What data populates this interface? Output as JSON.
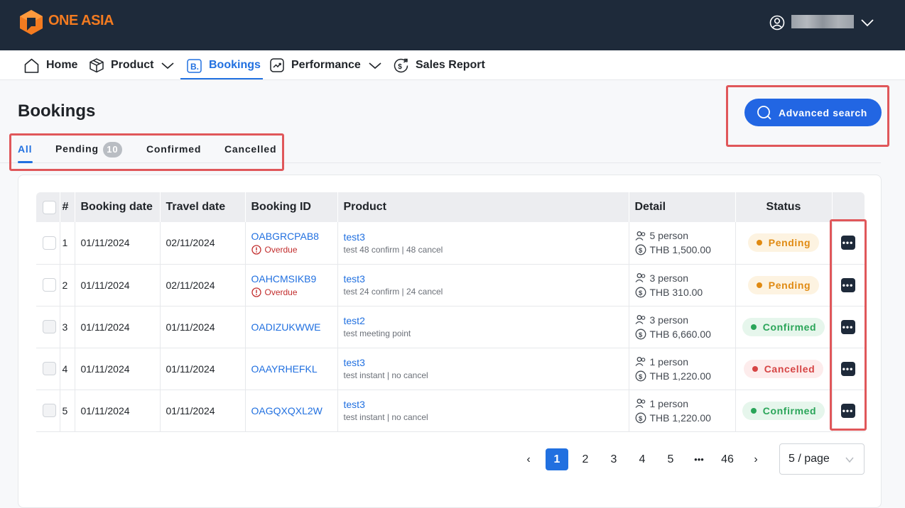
{
  "header": {
    "brand": "ONE ASIA",
    "user_icon": "user-circle-icon"
  },
  "nav": [
    {
      "label": "Home",
      "icon": "home-icon"
    },
    {
      "label": "Product",
      "icon": "box-icon"
    },
    {
      "label": "Bookings",
      "icon": "bookings-icon"
    },
    {
      "label": "Performance",
      "icon": "trend-icon"
    },
    {
      "label": "Sales Report",
      "icon": "money-icon"
    }
  ],
  "page": {
    "title": "Bookings",
    "advanced_search": "Advanced search"
  },
  "tabs": {
    "all": "All",
    "pending": "Pending",
    "pending_count": "10",
    "confirmed": "Confirmed",
    "cancelled": "Cancelled"
  },
  "table": {
    "columns": [
      "#",
      "Booking date",
      "Travel date",
      "Booking ID",
      "Product",
      "Detail",
      "Status"
    ],
    "rows": [
      {
        "n": "1",
        "booking_date": "01/11/2024",
        "travel_date": "02/11/2024",
        "booking_id": "OABGRCPAB8",
        "overdue": "Overdue",
        "product": "test3",
        "product_sub": "test 48 confirm | 48 cancel",
        "persons": "5 person",
        "price": "THB 1,500.00",
        "status": "Pending"
      },
      {
        "n": "2",
        "booking_date": "01/11/2024",
        "travel_date": "02/11/2024",
        "booking_id": "OAHCMSIKB9",
        "overdue": "Overdue",
        "product": "test3",
        "product_sub": "test 24 confirm | 24 cancel",
        "persons": "3 person",
        "price": "THB 310.00",
        "status": "Pending"
      },
      {
        "n": "3",
        "booking_date": "01/11/2024",
        "travel_date": "01/11/2024",
        "booking_id": "OADIZUKWWE",
        "overdue": "",
        "product": "test2",
        "product_sub": "test meeting point",
        "persons": "3 person",
        "price": "THB 6,660.00",
        "status": "Confirmed"
      },
      {
        "n": "4",
        "booking_date": "01/11/2024",
        "travel_date": "01/11/2024",
        "booking_id": "OAAYRHEFKL",
        "overdue": "",
        "product": "test3",
        "product_sub": "test instant | no cancel",
        "persons": "1 person",
        "price": "THB 1,220.00",
        "status": "Cancelled"
      },
      {
        "n": "5",
        "booking_date": "01/11/2024",
        "travel_date": "01/11/2024",
        "booking_id": "OAGQXQXL2W",
        "overdue": "",
        "product": "test3",
        "product_sub": "test instant | no cancel",
        "persons": "1 person",
        "price": "THB 1,220.00",
        "status": "Confirmed"
      }
    ]
  },
  "status_colors": {
    "Pending": {
      "bg": "#fdf3e1",
      "fg": "#e08a12"
    },
    "Confirmed": {
      "bg": "#e6f6ec",
      "fg": "#2aa559"
    },
    "Cancelled": {
      "bg": "#fdecec",
      "fg": "#d64545"
    }
  },
  "pagination": {
    "prev": "‹",
    "pages": [
      "1",
      "2",
      "3",
      "4",
      "5"
    ],
    "ellipsis": "•••",
    "last": "46",
    "next": "›",
    "current": "1",
    "per_page": "5 / page"
  }
}
